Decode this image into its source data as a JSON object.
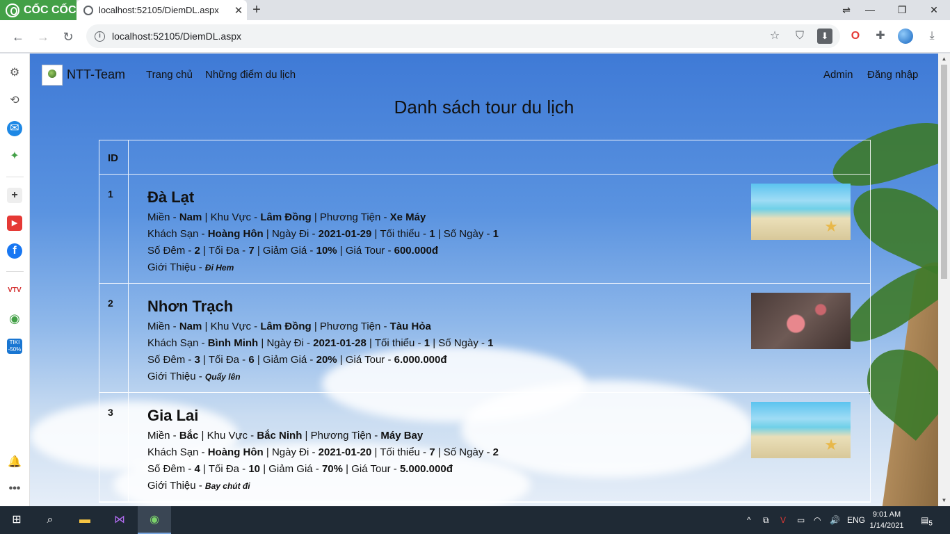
{
  "browser": {
    "brand_label": "CỐC CỐC",
    "tab_title": "localhost:52105/DiemDL.aspx",
    "url": "localhost:52105/DiemDL.aspx"
  },
  "site": {
    "brand": "NTT-Team",
    "nav_left": [
      "Trang chủ",
      "Những điểm du lịch"
    ],
    "nav_right": [
      "Admin",
      "Đăng nhập"
    ],
    "page_title": "Danh sách tour du lịch",
    "table_header_id": "ID"
  },
  "labels": {
    "mien": "Miền - ",
    "khu_vuc": "Khu Vực - ",
    "phuong_tien": "Phương Tiện - ",
    "khach_san": "Khách Sạn - ",
    "ngay_di": "Ngày Đi - ",
    "toi_thieu": "Tối thiểu - ",
    "so_ngay": "Số Ngày - ",
    "so_dem": "Số Đêm - ",
    "toi_da": "Tối Đa - ",
    "giam_gia": "Giảm Giá - ",
    "gia_tour": "Giá Tour - ",
    "gioi_thieu": "Giới Thiệu - "
  },
  "tours": [
    {
      "id": "1",
      "name": "Đà Lạt",
      "mien": "Nam",
      "khu_vuc": "Lâm Đồng",
      "phuong_tien": "Xe Máy",
      "khach_san": "Hoàng Hôn",
      "ngay_di": "2021-01-29",
      "toi_thieu": "1",
      "so_ngay": "1",
      "so_dem": "2",
      "toi_da": "7",
      "giam_gia": "10%",
      "gia_tour": "600.000đ",
      "gioi_thieu": "Đi Hem",
      "image": "beach"
    },
    {
      "id": "2",
      "name": "Nhơn Trạch",
      "mien": "Nam",
      "khu_vuc": "Lâm Đồng",
      "phuong_tien": "Tàu Hỏa",
      "khach_san": "Bình Minh",
      "ngay_di": "2021-01-28",
      "toi_thieu": "1",
      "so_ngay": "1",
      "so_dem": "3",
      "toi_da": "6",
      "giam_gia": "20%",
      "gia_tour": "6.000.000đ",
      "gioi_thieu": "Quẩy lên",
      "image": "flower"
    },
    {
      "id": "3",
      "name": "Gia Lai",
      "mien": "Bắc",
      "khu_vuc": "Bắc Ninh",
      "phuong_tien": "Máy Bay",
      "khach_san": "Hoàng Hôn",
      "ngay_di": "2021-01-20",
      "toi_thieu": "7",
      "so_ngay": "2",
      "so_dem": "4",
      "toi_da": "10",
      "giam_gia": "70%",
      "gia_tour": "5.000.000đ",
      "gioi_thieu": "Bay chút đi",
      "image": "beach"
    }
  ],
  "taskbar": {
    "language": "ENG",
    "time": "9:01 AM",
    "date": "1/14/2021",
    "notification_count": "5"
  },
  "colors": {
    "brand_green": "#43a047",
    "sky_blue": "#3f7ad6",
    "taskbar": "#1f2a35"
  }
}
